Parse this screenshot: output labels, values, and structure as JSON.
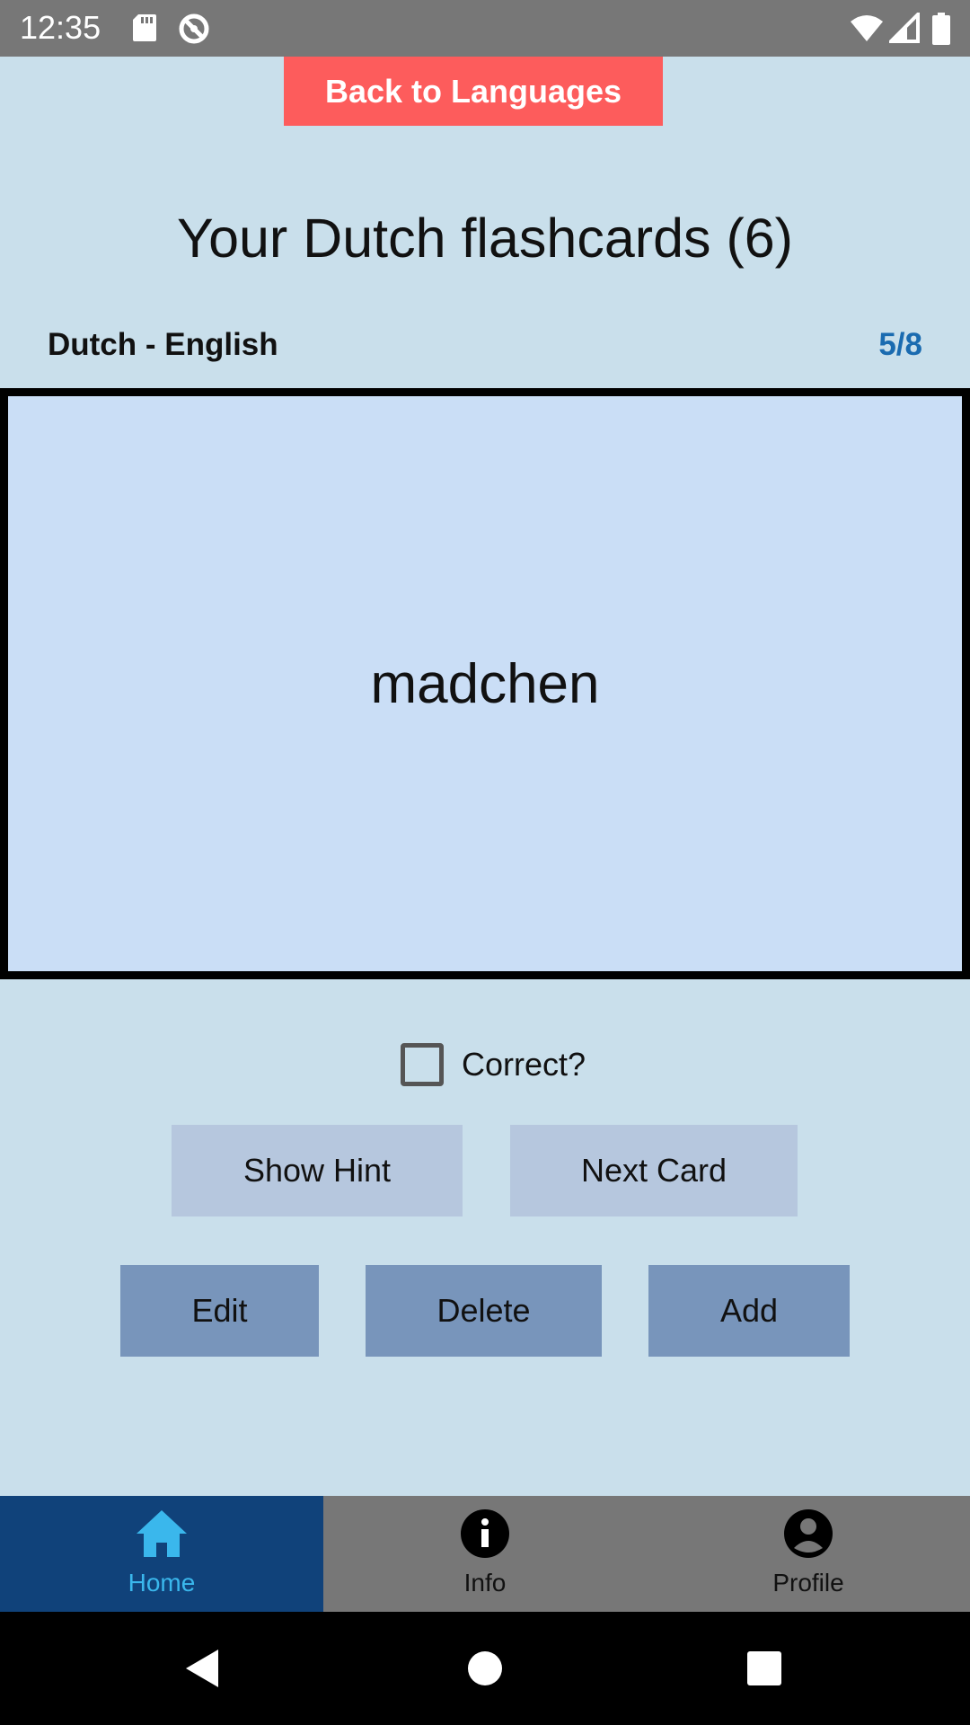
{
  "status_bar": {
    "time": "12:35",
    "icons": [
      "sd-card-icon",
      "sync-icon",
      "wifi-icon",
      "signal-icon",
      "battery-icon"
    ]
  },
  "header": {
    "back_button_label": "Back to Languages",
    "title": "Your Dutch flashcards (6)",
    "language_pair": "Dutch - English",
    "progress": "5/8"
  },
  "card": {
    "word": "madchen"
  },
  "controls": {
    "correct_label": "Correct?",
    "correct_checked": false,
    "show_hint_label": "Show Hint",
    "next_card_label": "Next Card",
    "edit_label": "Edit",
    "delete_label": "Delete",
    "add_label": "Add"
  },
  "bottom_nav": {
    "items": [
      {
        "label": "Home",
        "icon": "home-icon",
        "active": true
      },
      {
        "label": "Info",
        "icon": "info-icon",
        "active": false
      },
      {
        "label": "Profile",
        "icon": "profile-icon",
        "active": false
      }
    ]
  },
  "system_nav": {
    "icons": [
      "back-triangle-icon",
      "home-circle-icon",
      "recents-square-icon"
    ]
  },
  "colors": {
    "background": "#c9dfeb",
    "back_button": "#fd5c5c",
    "progress_text": "#1a6bb0",
    "card_background": "#cadef6",
    "nav_active": "#10427a",
    "nav_active_text": "#3ab7ec"
  }
}
